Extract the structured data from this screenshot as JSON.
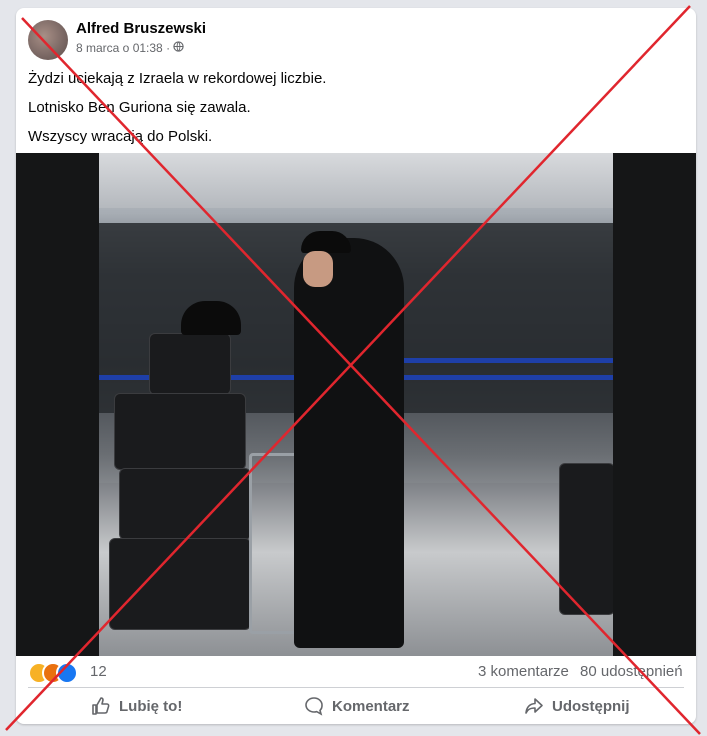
{
  "post": {
    "author": "Alfred Bruszewski",
    "date": "8 marca o 01:38",
    "separator": "·",
    "lines": [
      "Żydzi uciekają z Izraela w rekordowej liczbie.",
      "Lotnisko Ben Guriona się zawala.",
      "Wszyscy wracają do Polski."
    ]
  },
  "stats": {
    "reaction_count": "12",
    "comments": "3 komentarze",
    "shares": "80 udostępnień",
    "reactions": [
      "haha",
      "angry",
      "like"
    ]
  },
  "actions": {
    "like_label": "Lubię to!",
    "comment_label": "Komentarz",
    "share_label": "Udostępnij"
  },
  "colors": {
    "cross": "#e0262e",
    "link_gray": "#65676b",
    "accent_blue": "#1877f2"
  }
}
